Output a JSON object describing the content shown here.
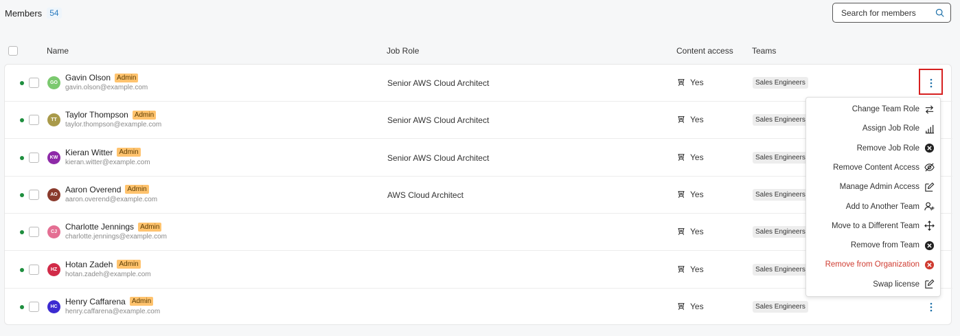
{
  "header": {
    "title": "Members",
    "count": "54"
  },
  "search": {
    "placeholder": "Search for members"
  },
  "columns": {
    "name": "Name",
    "job_role": "Job Role",
    "content_access": "Content access",
    "teams": "Teams"
  },
  "colors": {
    "active_dot": "#1e8e3e",
    "admin_badge": "#ffc36e",
    "danger": "#cf3b30",
    "highlight": "#d61f1f",
    "link": "#1b6fa8"
  },
  "members": [
    {
      "initials": "GO",
      "avatar_color": "#7bc96f",
      "name": "Gavin Olson",
      "badge": "Admin",
      "email": "gavin.olson@example.com",
      "job_role": "Senior AWS Cloud Architect",
      "access": "Yes",
      "team": "Sales Engineers"
    },
    {
      "initials": "TT",
      "avatar_color": "#a99a4a",
      "name": "Taylor Thompson",
      "badge": "Admin",
      "email": "taylor.thompson@example.com",
      "job_role": "Senior AWS Cloud Architect",
      "access": "Yes",
      "team": "Sales Engineers"
    },
    {
      "initials": "KW",
      "avatar_color": "#8e2aa8",
      "name": "Kieran Witter",
      "badge": "Admin",
      "email": "kieran.witter@example.com",
      "job_role": "Senior AWS Cloud Architect",
      "access": "Yes",
      "team": "Sales Engineers"
    },
    {
      "initials": "AO",
      "avatar_color": "#8a3a2c",
      "name": "Aaron Overend",
      "badge": "Admin",
      "email": "aaron.overend@example.com",
      "job_role": "AWS Cloud Architect",
      "access": "Yes",
      "team": "Sales Engineers"
    },
    {
      "initials": "CJ",
      "avatar_color": "#e46f93",
      "name": "Charlotte Jennings",
      "badge": "Admin",
      "email": "charlotte.jennings@example.com",
      "job_role": "",
      "access": "Yes",
      "team": "Sales Engineers"
    },
    {
      "initials": "HZ",
      "avatar_color": "#d12b48",
      "name": "Hotan Zadeh",
      "badge": "Admin",
      "email": "hotan.zadeh@example.com",
      "job_role": "",
      "access": "Yes",
      "team": "Sales Engineers"
    },
    {
      "initials": "HC",
      "avatar_color": "#3c2bd1",
      "name": "Henry Caffarena",
      "badge": "Admin",
      "email": "henry.caffarena@example.com",
      "job_role": "",
      "access": "Yes",
      "team": "Sales Engineers"
    }
  ],
  "menu": {
    "items": [
      {
        "label": "Change Team Role",
        "icon": "swap-arrows-icon"
      },
      {
        "label": "Assign Job Role",
        "icon": "bar-chart-icon"
      },
      {
        "label": "Remove Job Role",
        "icon": "remove-circle-icon"
      },
      {
        "label": "Remove Content Access",
        "icon": "eye-off-icon"
      },
      {
        "label": "Manage Admin Access",
        "icon": "edit-box-icon"
      },
      {
        "label": "Add to Another Team",
        "icon": "add-user-icon"
      },
      {
        "label": "Move to a Different Team",
        "icon": "move-arrows-icon"
      },
      {
        "label": "Remove from Team",
        "icon": "remove-circle-icon"
      },
      {
        "label": "Remove from Organization",
        "icon": "remove-circle-danger-icon"
      },
      {
        "label": "Swap license",
        "icon": "edit-box-icon"
      }
    ]
  }
}
